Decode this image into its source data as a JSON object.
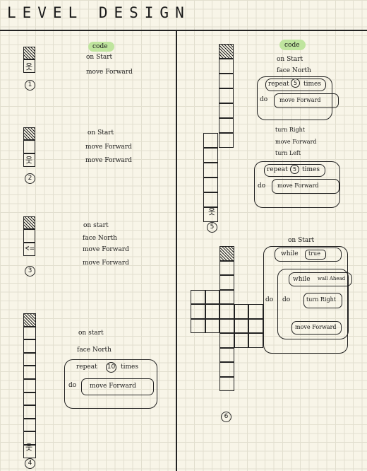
{
  "title": "LEVEL DESIGN",
  "levels": [
    {
      "number": "1",
      "code_label": "code",
      "lines": [
        "on Start",
        "move Forward"
      ]
    },
    {
      "number": "2",
      "lines": [
        "on Start",
        "move Forward",
        "move Forward"
      ]
    },
    {
      "number": "3",
      "lines": [
        "on start",
        "face North",
        "move Forward",
        "move Forward"
      ]
    },
    {
      "number": "4",
      "lines": [
        "on start",
        "face North",
        "repeat",
        "10",
        "times",
        "do",
        "move Forward"
      ]
    },
    {
      "number": "5",
      "code_label": "code",
      "lines": [
        "on Start",
        "face North",
        "repeat",
        "5",
        "times",
        "do",
        "move Forward",
        "turn Right",
        "move Forward",
        "turn Left",
        "repeat",
        "5",
        "times",
        "do",
        "move Forward"
      ]
    },
    {
      "number": "6",
      "lines": [
        "on Start",
        "while",
        "true",
        "do",
        "while",
        "wall Ahead",
        "do",
        "turn Right",
        "move Forward"
      ]
    }
  ],
  "icons": {
    "robot": "robot-icon",
    "arrow": "facing-arrow-icon",
    "hatch": "goal-hatch"
  },
  "colors": {
    "highlight": "#bfe59e",
    "ink": "#222222",
    "paper": "#f8f5e8"
  }
}
